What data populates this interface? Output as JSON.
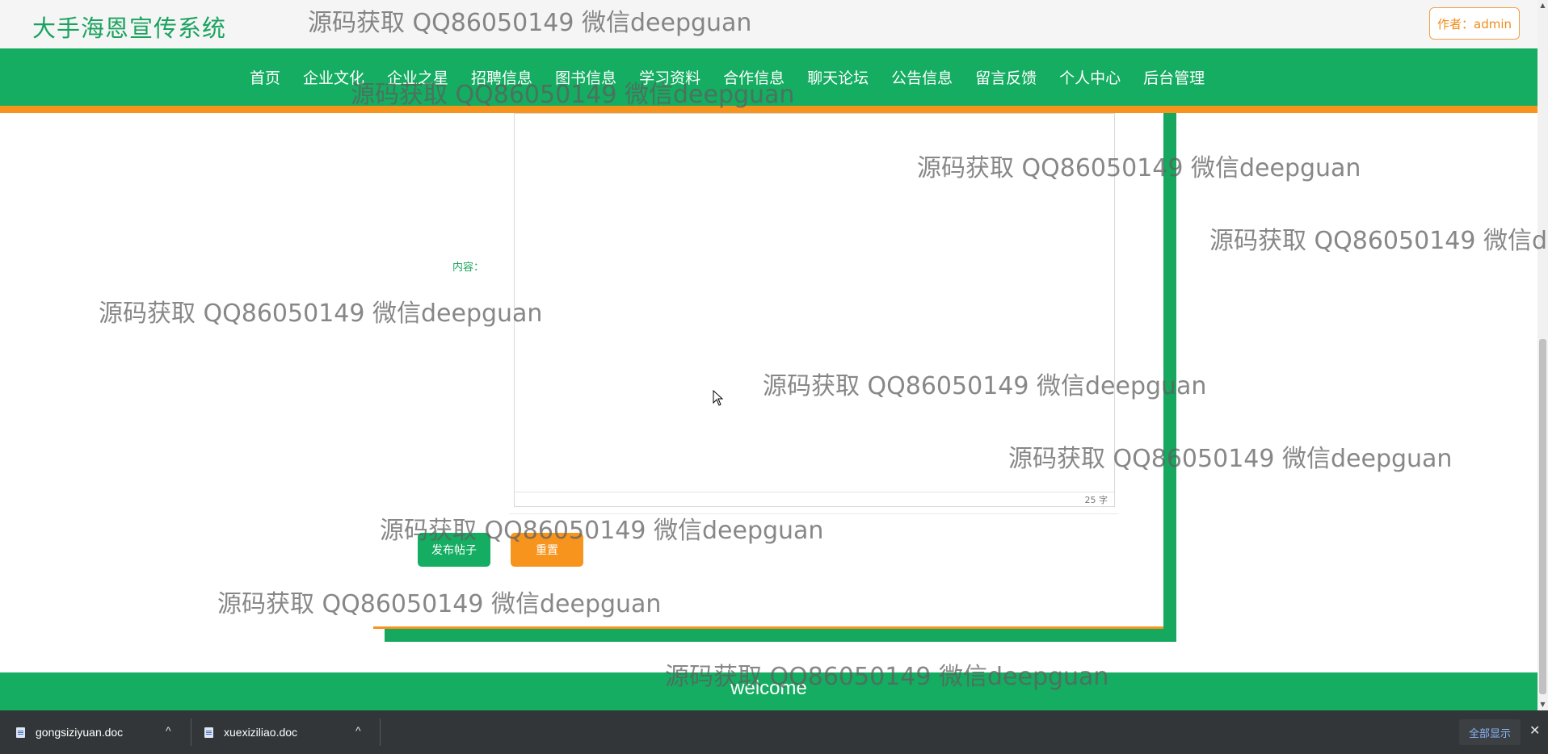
{
  "header": {
    "brand": "大手海恩宣传系统",
    "author_button": "作者：admin"
  },
  "nav": {
    "items": [
      "首页",
      "企业文化",
      "企业之星",
      "招聘信息",
      "图书信息",
      "学习资料",
      "合作信息",
      "聊天论坛",
      "公告信息",
      "留言反馈",
      "个人中心",
      "后台管理"
    ]
  },
  "form": {
    "content_label": "内容：",
    "word_count": "25 字",
    "publish_button": "发布帖子",
    "reset_button": "重置"
  },
  "footer": {
    "text": "welcome"
  },
  "watermark": "源码获取 QQ86050149 微信deepguan",
  "downloads": {
    "items": [
      "gongsiziyuan.doc",
      "xuexiziliao.doc"
    ],
    "show_all": "全部显示"
  },
  "colors": {
    "brand_green": "#14ad61",
    "accent_orange": "#f7941d"
  }
}
